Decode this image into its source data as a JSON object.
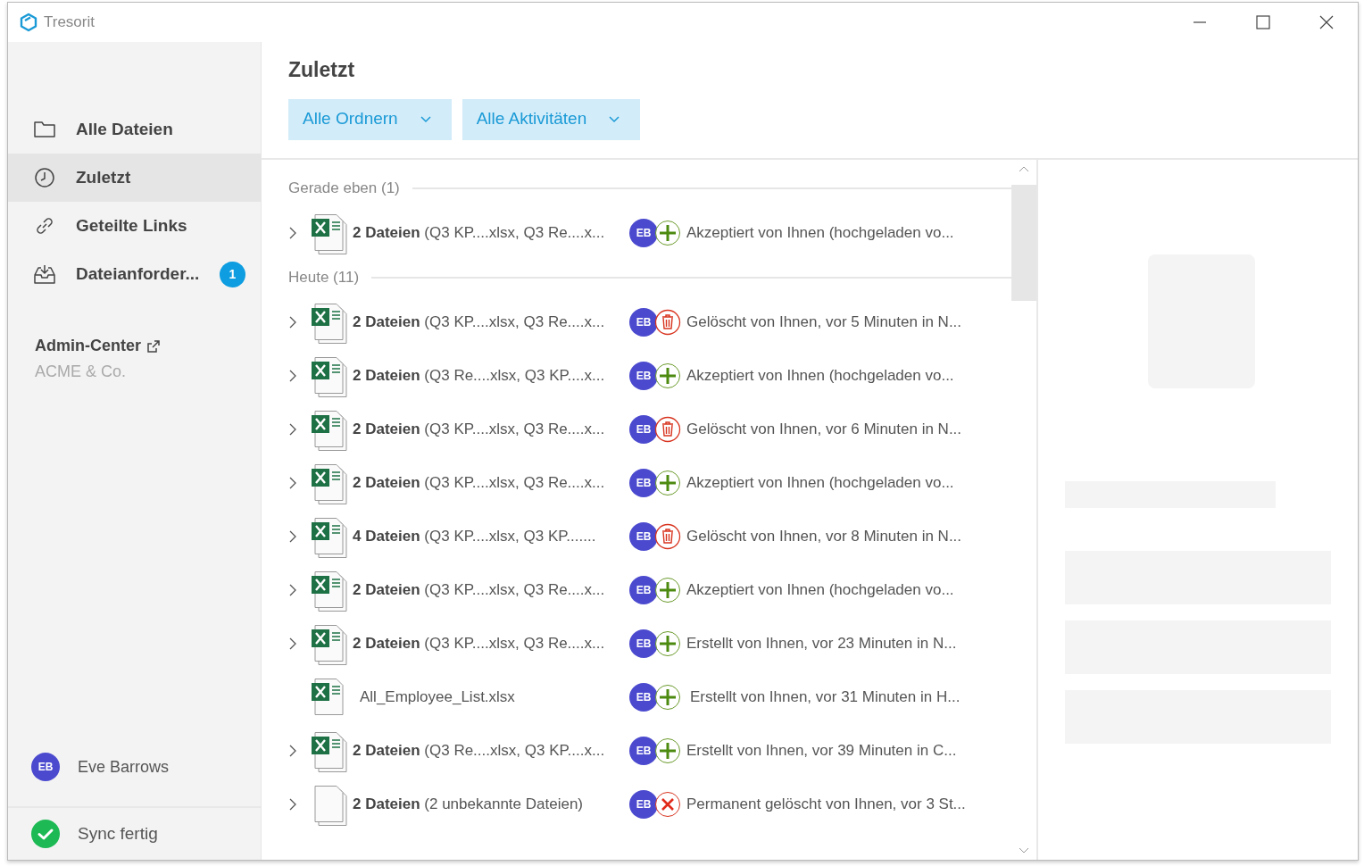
{
  "window": {
    "title": "Tresorit"
  },
  "sidebar": {
    "items": [
      {
        "label": "Alle Dateien",
        "selected": false
      },
      {
        "label": "Zuletzt",
        "selected": true
      },
      {
        "label": "Geteilte Links",
        "selected": false
      },
      {
        "label": "Dateianforder...",
        "selected": false,
        "badge": "1"
      }
    ],
    "admin": {
      "label": "Admin-Center",
      "org": "ACME & Co."
    },
    "user": {
      "initials": "EB",
      "name": "Eve Barrows"
    },
    "status": "Sync fertig"
  },
  "header": {
    "title": "Zuletzt",
    "filters": [
      "Alle Ordnern",
      "Alle Aktivitäten"
    ]
  },
  "groups": [
    {
      "label": "Gerade eben (1)",
      "rows": [
        {
          "expandable": true,
          "file": {
            "kind": "excel-stack",
            "name": "**2 Dateien** (Q3 KP....xlsx, Q3 Re....x..."
          },
          "activity": {
            "kind": "added",
            "initials": "EB",
            "text": "Akzeptiert von Ihnen (hochgeladen vo..."
          }
        }
      ]
    },
    {
      "label": "Heute (11)",
      "rows": [
        {
          "expandable": true,
          "file": {
            "kind": "excel-stack",
            "name": "**2 Dateien** (Q3 KP....xlsx, Q3 Re....x..."
          },
          "activity": {
            "kind": "deleted",
            "initials": "EB",
            "text": "Gelöscht von Ihnen, vor 5 Minuten in N..."
          }
        },
        {
          "expandable": true,
          "file": {
            "kind": "excel-stack",
            "name": "**2 Dateien** (Q3 Re....xlsx, Q3 KP....x..."
          },
          "activity": {
            "kind": "added",
            "initials": "EB",
            "text": "Akzeptiert von Ihnen (hochgeladen vo..."
          }
        },
        {
          "expandable": true,
          "file": {
            "kind": "excel-stack",
            "name": "**2 Dateien** (Q3 KP....xlsx, Q3 Re....x..."
          },
          "activity": {
            "kind": "deleted",
            "initials": "EB",
            "text": "Gelöscht von Ihnen, vor 6 Minuten in N..."
          }
        },
        {
          "expandable": true,
          "file": {
            "kind": "excel-stack",
            "name": "**2 Dateien** (Q3 KP....xlsx, Q3 Re....x..."
          },
          "activity": {
            "kind": "added",
            "initials": "EB",
            "text": "Akzeptiert von Ihnen (hochgeladen vo..."
          }
        },
        {
          "expandable": true,
          "file": {
            "kind": "excel-stack",
            "name": "**4 Dateien** (Q3 KP....xlsx, Q3 KP......."
          },
          "activity": {
            "kind": "deleted",
            "initials": "EB",
            "text": "Gelöscht von Ihnen, vor 8 Minuten in N..."
          }
        },
        {
          "expandable": true,
          "file": {
            "kind": "excel-stack",
            "name": "**2 Dateien** (Q3 KP....xlsx, Q3 Re....x..."
          },
          "activity": {
            "kind": "added",
            "initials": "EB",
            "text": "Akzeptiert von Ihnen (hochgeladen vo..."
          }
        },
        {
          "expandable": true,
          "file": {
            "kind": "excel-stack",
            "name": "**2 Dateien** (Q3 KP....xlsx, Q3 Re....x..."
          },
          "activity": {
            "kind": "added",
            "initials": "EB",
            "text": "Erstellt von Ihnen, vor 23 Minuten in N..."
          }
        },
        {
          "expandable": false,
          "file": {
            "kind": "excel",
            "name": "All_Employee_List.xlsx"
          },
          "activity": {
            "kind": "added",
            "initials": "EB",
            "text": "Erstellt von Ihnen, vor 31 Minuten in H..."
          }
        },
        {
          "expandable": true,
          "file": {
            "kind": "excel-stack",
            "name": "**2 Dateien** (Q3 Re....xlsx, Q3 KP....x..."
          },
          "activity": {
            "kind": "added",
            "initials": "EB",
            "text": "Erstellt von Ihnen, vor 39 Minuten in C..."
          }
        },
        {
          "expandable": true,
          "file": {
            "kind": "blank-stack",
            "name": "**2 Dateien** (2 unbekannte Dateien)"
          },
          "activity": {
            "kind": "removed",
            "initials": "EB",
            "text": "Permanent gelöscht von Ihnen, vor 3 St..."
          }
        }
      ]
    }
  ]
}
